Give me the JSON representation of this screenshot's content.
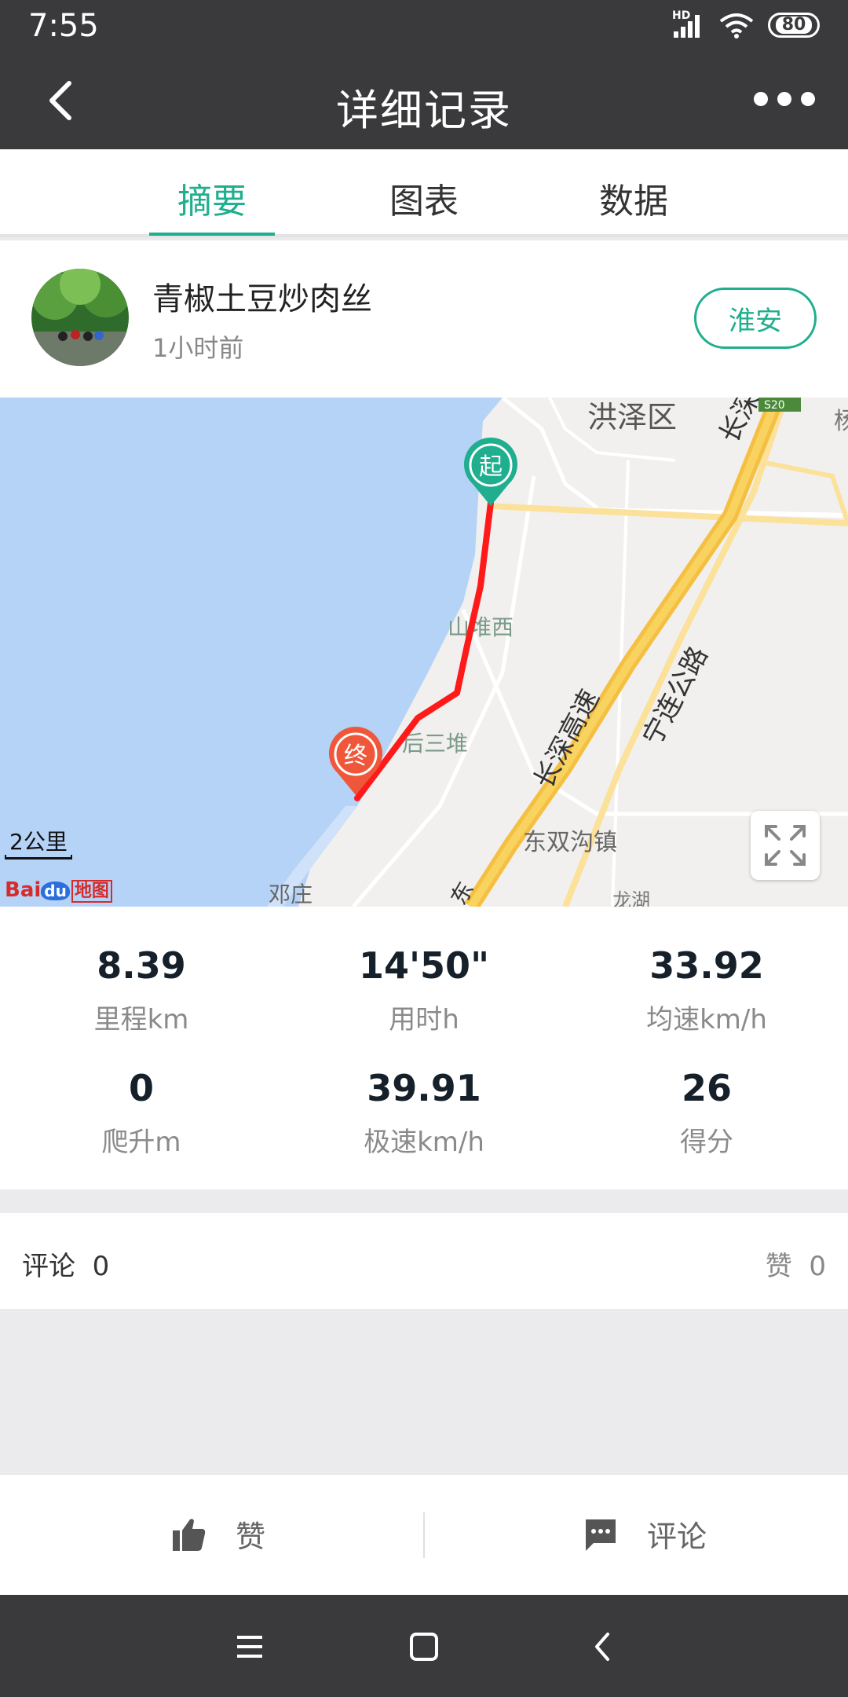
{
  "status_bar": {
    "time": "7:55",
    "network": "HD",
    "battery": "80"
  },
  "header": {
    "title": "详细记录"
  },
  "tabs": [
    {
      "label": "摘要",
      "active": true
    },
    {
      "label": "图表",
      "active": false
    },
    {
      "label": "数据",
      "active": false
    }
  ],
  "user": {
    "name": "青椒土豆炒肉丝",
    "time": "1小时前",
    "follow_label": "淮安"
  },
  "map": {
    "labels": {
      "district": "洪泽区",
      "highway1": "长深高速",
      "highway2": "长深高速",
      "road": "宁连公路",
      "place1": "山堆西",
      "place2": "后三堆",
      "town": "东双沟镇",
      "village": "邓庄",
      "road_number": "S20",
      "edge_char": "杨",
      "edge_char2": "东",
      "edge_char3": "龙湖"
    },
    "start_marker": "起",
    "end_marker": "终",
    "scale": "2公里",
    "logo": {
      "bai": "Bai",
      "du": "du",
      "map": "地图"
    },
    "colors": {
      "route": "#ff1a1a",
      "start": "#1fae8e",
      "end": "#f0573a",
      "water": "#b5d3f7",
      "highway": "#f5c042"
    }
  },
  "stats": [
    {
      "value": "8.39",
      "label": "里程km"
    },
    {
      "value": "14'50\"",
      "label": "用时h"
    },
    {
      "value": "33.92",
      "label": "均速km/h"
    },
    {
      "value": "0",
      "label": "爬升m"
    },
    {
      "value": "39.91",
      "label": "极速km/h"
    },
    {
      "value": "26",
      "label": "得分"
    }
  ],
  "comments": {
    "label": "评论",
    "count": "0",
    "likes_label": "赞",
    "likes_count": "0"
  },
  "actions": {
    "like_label": "赞",
    "comment_label": "评论"
  },
  "colors": {
    "accent": "#1fae8e",
    "bar": "#3a3a3c"
  }
}
